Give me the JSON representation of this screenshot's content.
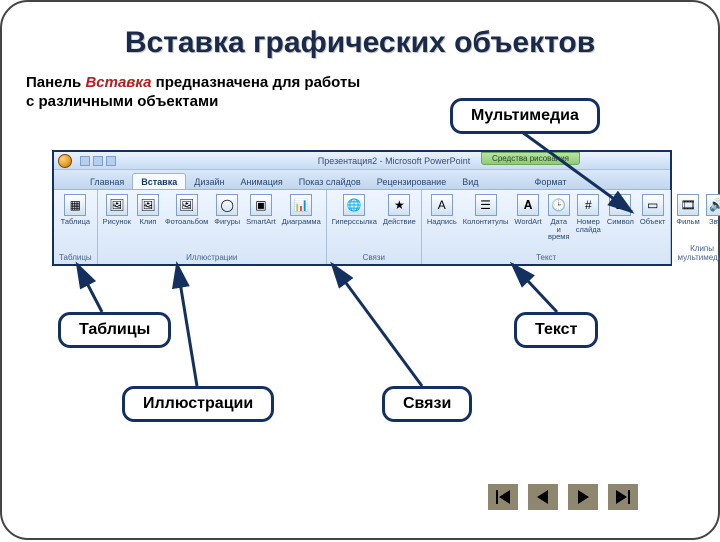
{
  "title": "Вставка графических объектов",
  "intro_pre": "Панель ",
  "intro_hl": "Вставка",
  "intro_post": " предназначена для работы с различными объектами",
  "win": {
    "doc": "Презентация2 - Microsoft PowerPoint",
    "context": "Средства рисования"
  },
  "tabs": [
    "Главная",
    "Вставка",
    "Дизайн",
    "Анимация",
    "Показ слайдов",
    "Рецензирование",
    "Вид",
    "Формат"
  ],
  "groups": {
    "tables": {
      "label": "Таблицы",
      "items": [
        {
          "l": "Таблица",
          "i": "▦"
        }
      ]
    },
    "illus": {
      "label": "Иллюстрации",
      "items": [
        {
          "l": "Рисунок",
          "i": "🖼"
        },
        {
          "l": "Клип",
          "i": "🖼"
        },
        {
          "l": "Фотоальбом",
          "i": "🖼"
        },
        {
          "l": "Фигуры",
          "i": "◯"
        },
        {
          "l": "SmartArt",
          "i": "▣"
        },
        {
          "l": "Диаграмма",
          "i": "📊"
        }
      ]
    },
    "links": {
      "label": "Связи",
      "items": [
        {
          "l": "Гиперссылка",
          "i": "🌐"
        },
        {
          "l": "Действие",
          "i": "★"
        }
      ]
    },
    "text": {
      "label": "Текст",
      "items": [
        {
          "l": "Надпись",
          "i": "A"
        },
        {
          "l": "Колонтитулы",
          "i": "☰"
        },
        {
          "l": "WordArt",
          "i": "𝐀"
        },
        {
          "l": "Дата и время",
          "i": "🕒"
        },
        {
          "l": "Номер слайда",
          "i": "#"
        },
        {
          "l": "Символ",
          "i": "Ω"
        },
        {
          "l": "Объект",
          "i": "▭"
        }
      ]
    },
    "media": {
      "label": "Клипы мультимедиа",
      "items": [
        {
          "l": "Фильм",
          "i": "🎞"
        },
        {
          "l": "Звук",
          "i": "🔊"
        }
      ]
    }
  },
  "callouts": {
    "multimedia": "Мультимедиа",
    "tables": "Таблицы",
    "text": "Текст",
    "illus": "Иллюстрации",
    "links": "Связи"
  }
}
